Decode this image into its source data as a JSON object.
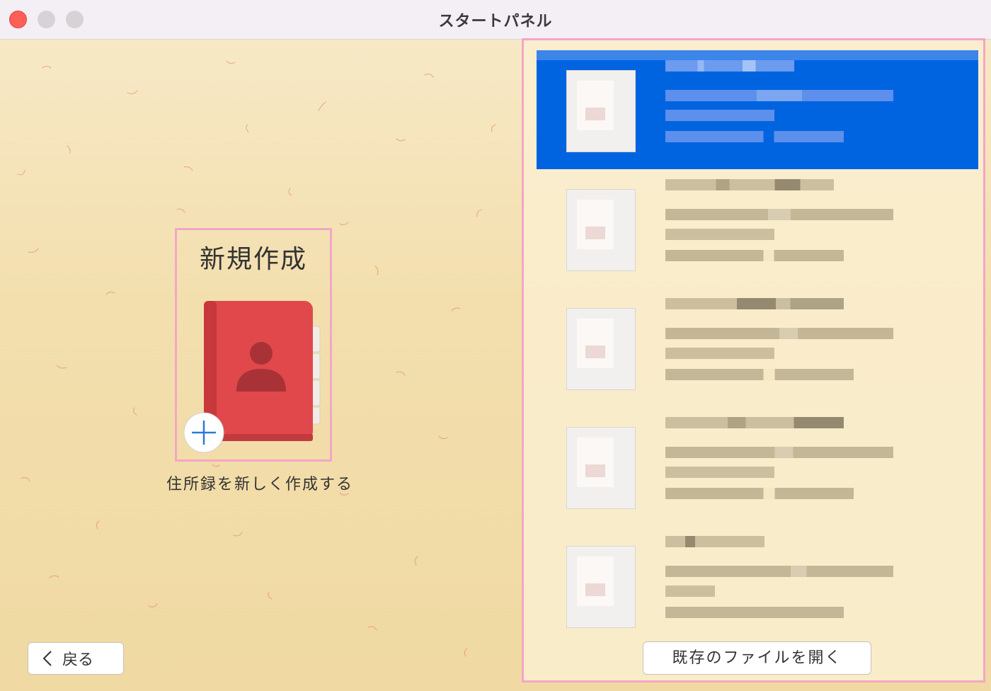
{
  "window": {
    "title": "スタートパネル"
  },
  "new_document": {
    "heading": "新規作成",
    "caption": "住所録を新しく作成する",
    "icon": "address-book-icon"
  },
  "buttons": {
    "back_label": "戻る",
    "open_existing_label": "既存のファイルを開く"
  },
  "recent_files": {
    "selected_index": 0,
    "count": 5,
    "content_note": "file names, paths and dates are pixelated/obscured in the screenshot"
  },
  "colors": {
    "selection": "#0064e1",
    "highlight_border": "#f4a6c6",
    "close_button": "#fe5f57",
    "book_red": "#e0484c"
  }
}
